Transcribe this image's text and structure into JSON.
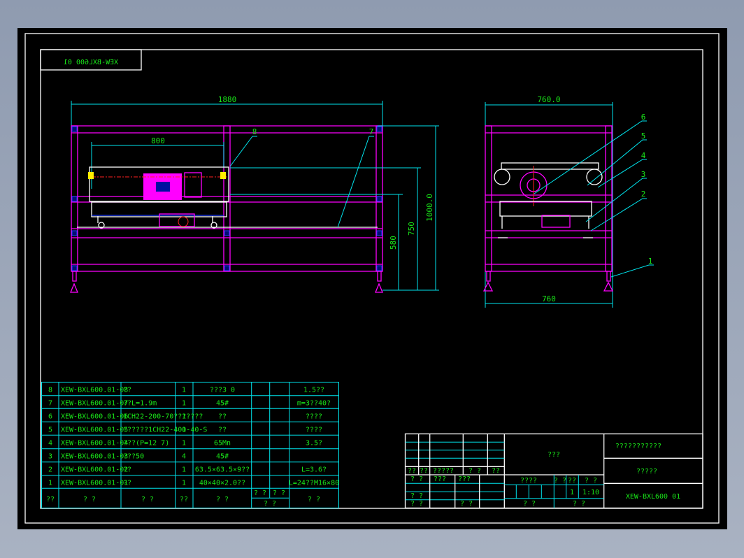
{
  "drawing_code_mirrored": "XEW-BXL600 01",
  "front_view": {
    "dims": {
      "overall_length": "1880",
      "machine_length": "800",
      "height_total": "1000.0",
      "height_mid": "750",
      "height_low": "580"
    },
    "callouts": [
      "8",
      "7"
    ]
  },
  "side_view": {
    "dims": {
      "top_width": "760.0",
      "bottom_width": "760"
    },
    "callouts": [
      "6",
      "5",
      "4",
      "3",
      "2",
      "1"
    ]
  },
  "parts_table": {
    "rows": [
      {
        "no": "8",
        "code": "XEW-BXL600.01-08",
        "name": "??",
        "qty": "1",
        "material": "???3 0",
        "remark": "1.5??"
      },
      {
        "no": "7",
        "code": "XEW-BXL600.01-07",
        "name": "??L=1.9m",
        "qty": "1",
        "material": "45#",
        "remark": "m=3??40?"
      },
      {
        "no": "6",
        "code": "XEW-BXL600.01-06",
        "name": "1CH22-200-70???????",
        "qty": "1",
        "material": "??",
        "remark": "????"
      },
      {
        "no": "5",
        "code": "XEW-BXL600.01-05",
        "name": "??????1CH22-400-40-S",
        "qty": "1",
        "material": "??",
        "remark": "????"
      },
      {
        "no": "4",
        "code": "XEW-BXL600.01-04",
        "name": "???(P=12 7)",
        "qty": "1",
        "material": "65Mn",
        "remark": "3.5?"
      },
      {
        "no": "3",
        "code": "XEW-BXL600.01-03",
        "name": "???50",
        "qty": "4",
        "material": "45#",
        "remark": ""
      },
      {
        "no": "2",
        "code": "XEW-BXL600.01-02",
        "name": "??",
        "qty": "1",
        "material": "63.5×63.5×9??",
        "remark": "L=3.6?"
      },
      {
        "no": "1",
        "code": "XEW-BXL600.01-01",
        "name": "??",
        "qty": "1",
        "material": "40×40×2.0??",
        "remark": "L=24??M16×80"
      }
    ],
    "header": {
      "no": "??",
      "code": "? ?",
      "name": "? ?",
      "qty": "??",
      "material": "? ?",
      "w1": "? ?",
      "w2": "? ?",
      "weight": "? ?",
      "remark": "? ?"
    }
  },
  "title_block": {
    "drawing_name": "???",
    "company": "???????????",
    "subtitle": "?????",
    "drawing_no": "XEW-BXL600 01",
    "rev_labels": [
      "??",
      "??",
      "?????",
      "? ?",
      "??"
    ],
    "sign_labels": [
      "? ?",
      "???",
      "???"
    ],
    "sign_rows": [
      "? ?",
      "? ?"
    ],
    "sign_col3": "? ?",
    "stage": "????",
    "mass": "? ?",
    "scale_label": "??",
    "ratio_label": "? ?",
    "qty_value": "1",
    "scale_value": "1:10",
    "sheet_a": "? ?",
    "sheet_b": "? ?"
  }
}
